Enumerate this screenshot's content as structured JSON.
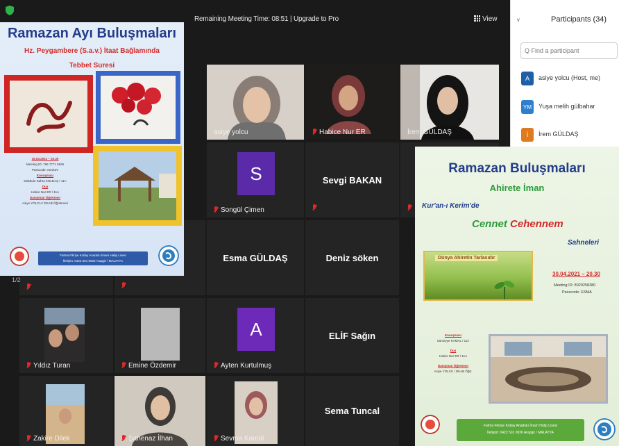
{
  "zoom": {
    "meeting_time": "Remaining Meeting Time: 08:51 | Upgrade to Pro",
    "view_label": "View",
    "page_indicator": "1/2",
    "tiles": {
      "asiye": "asiye yolcu",
      "habice": "Habice Nur ER",
      "irem": "İrem GÜLDAŞ",
      "songul": "Songül Çimen",
      "songul_initial": "S",
      "sevgi": "Sevgi BAKAN",
      "esma": "Esma GÜLDAŞ",
      "deniz": "Deniz söken",
      "yildiz": "Yıldız Turan",
      "emine": "Emine Özdemir",
      "ayten": "Ayten Kurtulmuş",
      "ayten_initial": "A",
      "elif": "ELİF Sağın",
      "zakire": "Zakire Dilek",
      "sahenaz": "Şahenaz İlhan",
      "sevma": "Sevma Kamal",
      "sema": "Sema Tuncal"
    },
    "colors": {
      "active_border": "#d8e36c",
      "muted_mic": "#e02828",
      "tile_bg": "#242424"
    }
  },
  "participants": {
    "title": "Participants (34)",
    "search_placeholder": "Q Find a participant",
    "items": [
      {
        "initials": "A",
        "name": "asiye yolcu (Host, me)",
        "color": "#1f5fa8"
      },
      {
        "initials": "YM",
        "name": "Yuşa melih gülbahar",
        "color": "#2f7fcf"
      },
      {
        "initials": "İ",
        "name": "İrem GÜLDAŞ",
        "color": "#e07a1f"
      }
    ]
  },
  "poster1": {
    "title": "Ramazan Ayı Buluşmaları",
    "subtitle": "Hz. Peygambere (S.a.v.) İtaat Bağlamında",
    "subtitle2": "Tebbet Suresi",
    "info": {
      "date": "16.04.2021 – 20.30",
      "meeting": "Meeting ID: 786 7771 5926",
      "passcode": "Passcode: eGvk3V",
      "role1": "Konuşmacı",
      "person1": "Makbule Sahra KOLDAŞ / 11A",
      "role2": "Dua",
      "person2": "Hatice Nur ER / 11A",
      "role3": "Danışman Öğretmen",
      "person3": "Asiye YOLCU / DKAB Öğretmeni"
    },
    "footer1": "Fatma Fikriye Kutlay Anadolu İmam Hatip Lisesi",
    "footer2": "İletişim: 0422 501 0026 Arapgir / MALATYA"
  },
  "poster2": {
    "title": "Ramazan Buluşmaları",
    "subtitle": "Ahirete İman",
    "line1": "Kur'an-ı Kerim'de",
    "line2_a": "Cennet ",
    "line2_b": "Cehennem",
    "line3": "Sahneleri",
    "image_caption": "Dünya Ahiretin Tarlasıdır",
    "date": "30.04.2021 – 20.30",
    "meeting": "Meeting ID: 8020258380",
    "passcode": "Passcode: ESMA",
    "info": {
      "role1": "Konuşmacı",
      "person1": "Sümeyye KAMAL / 11A",
      "role2": "Dua",
      "person2": "Hatice Nur ER / 11A",
      "role3": "Danışman Öğretmen",
      "person3": "Asiye YOLCU / DKAB Öğrt."
    },
    "footer1": "Fatma Fikriye Kutlay Anadolu İmam Hatip Lisesi",
    "footer2": "İletişim: 0422 501 0026 Arapgir / MALATYA"
  }
}
